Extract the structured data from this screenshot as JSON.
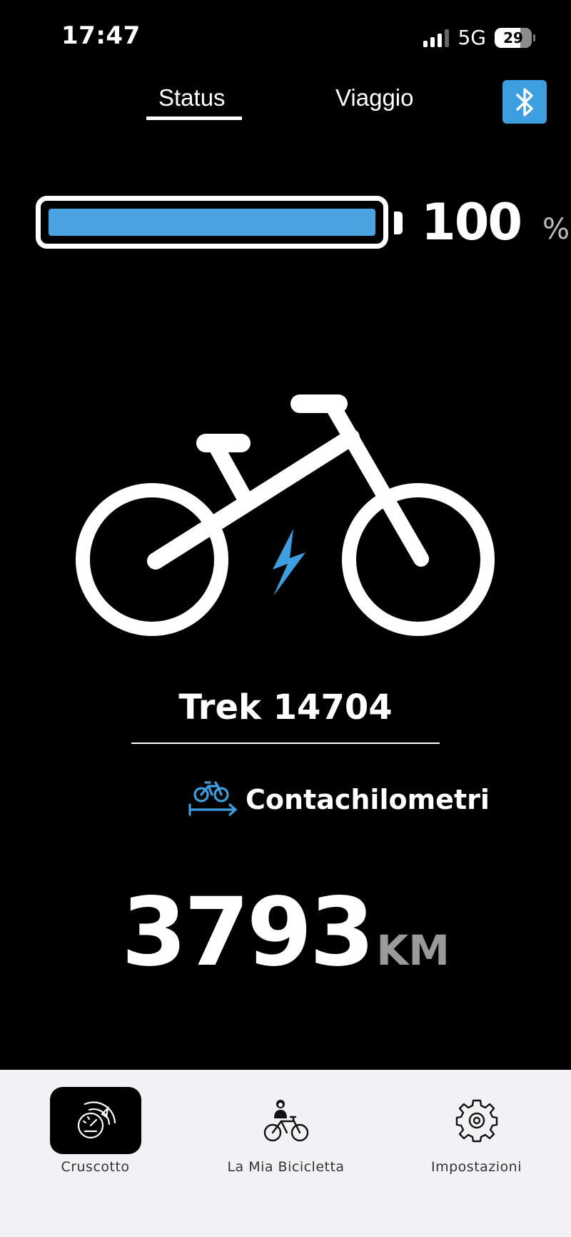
{
  "status_bar": {
    "time": "17:47",
    "network": "5G",
    "battery_level": "29"
  },
  "tabs": [
    {
      "label": "Status",
      "active": true
    },
    {
      "label": "Viaggio",
      "active": false
    }
  ],
  "battery": {
    "percent_value": "100",
    "percent_unit": "%",
    "fill_fraction": 1.0,
    "fill_color": "#4aa3e0"
  },
  "bike": {
    "name": "Trek 14704"
  },
  "odometer": {
    "label": "Contachilometri",
    "value": "3793",
    "unit": "KM"
  },
  "bottom_nav": [
    {
      "label": "Cruscotto",
      "icon": "dashboard-gauge-icon",
      "active": true
    },
    {
      "label": "La Mia Bicicletta",
      "icon": "rider-bike-icon",
      "active": false
    },
    {
      "label": "Impostazioni",
      "icon": "gear-icon",
      "active": false
    }
  ],
  "colors": {
    "accent": "#3d9fe0",
    "background": "#000000",
    "nav_background": "#f2f2f6"
  }
}
